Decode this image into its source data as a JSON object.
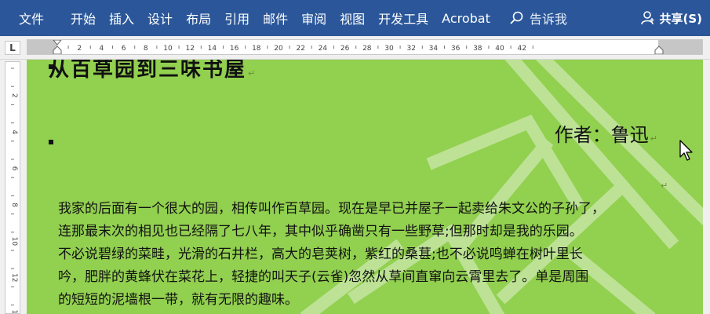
{
  "ribbon": {
    "file_tab": "文件",
    "tabs": [
      "开始",
      "插入",
      "设计",
      "布局",
      "引用",
      "邮件",
      "审阅",
      "视图",
      "开发工具",
      "Acrobat"
    ],
    "tell_me": "告诉我",
    "share": "共享(S)",
    "background_color": "#2b579a"
  },
  "ruler": {
    "corner_label": "L",
    "h_numbers": [
      "2",
      "4",
      "6",
      "8",
      "10",
      "12",
      "14",
      "16",
      "18",
      "20",
      "22",
      "24",
      "26",
      "28",
      "30",
      "32",
      "34",
      "36",
      "38",
      "40",
      "42"
    ],
    "v_numbers": [
      "2",
      "4",
      "6",
      "8",
      "10",
      "12",
      "14"
    ]
  },
  "document": {
    "page_color": "#92d050",
    "title": "从百草园到三味书屋",
    "author": "作者：鲁迅",
    "paragraph_mark": "↵",
    "body_lines": [
      "我家的后面有一个很大的园，相传叫作百草园。现在是早已并屋子一起卖给朱文公的子孙了，",
      "连那最末次的相见也已经隔了七八年，其中似乎确凿只有一些野草;但那时却是我的乐园。",
      "不必说碧绿的菜畦，光滑的石井栏，高大的皂荚树，紫红的桑葚;也不必说鸣蝉在树叶里长",
      "吟，肥胖的黄蜂伏在菜花上，轻捷的叫天子(云雀)忽然从草间直窜向云霄里去了。单是周围",
      "的短短的泥墙根一带，就有无限的趣味。"
    ]
  }
}
